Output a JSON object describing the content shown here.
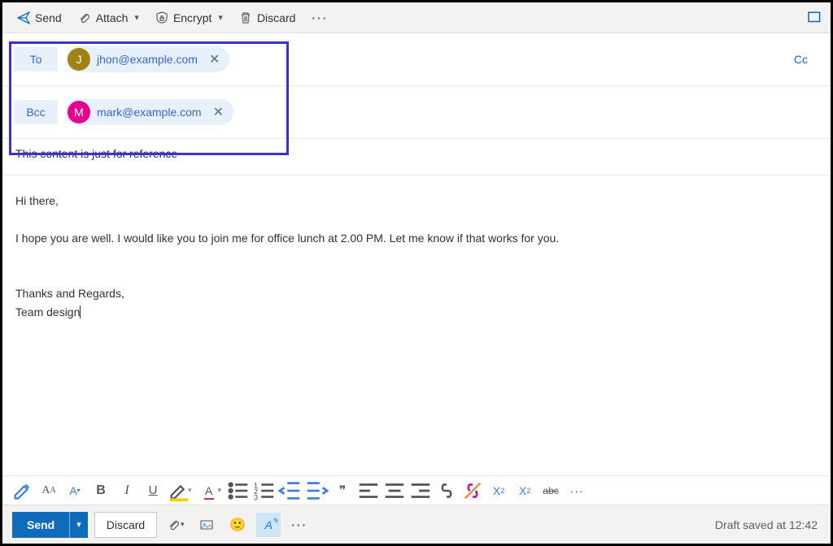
{
  "toolbar": {
    "send": "Send",
    "attach": "Attach",
    "encrypt": "Encrypt",
    "discard": "Discard"
  },
  "recipients": {
    "to_label": "To",
    "bcc_label": "Bcc",
    "cc_label": "Cc",
    "to_chip": {
      "initial": "J",
      "email": "jhon@example.com",
      "color": "#a08314"
    },
    "bcc_chip": {
      "initial": "M",
      "email": "mark@example.com",
      "color": "#e3008c"
    }
  },
  "subject": "This content is just for reference",
  "body": {
    "greeting": "Hi there,",
    "line1": "I hope you are well. I would like you to join me for office lunch at 2.00 PM. Let me know if that works for you.",
    "signoff1": "Thanks and Regards,",
    "signoff2": "Team design"
  },
  "bottom": {
    "send": "Send",
    "discard": "Discard",
    "status": "Draft saved at 12:42"
  },
  "fmt": {
    "bold": "B",
    "italic": "I",
    "underline": "U",
    "quote": "❞",
    "super": "X",
    "super2": "2",
    "sub": "X",
    "sub2": "2",
    "strike": "abc"
  }
}
